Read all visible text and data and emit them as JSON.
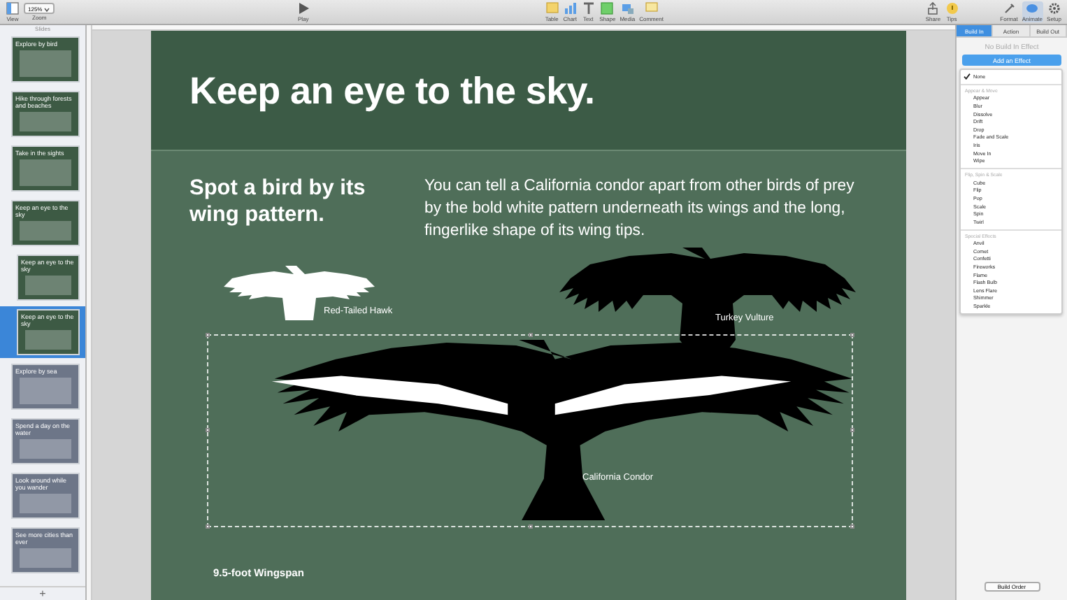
{
  "toolbar": {
    "left": [
      {
        "label": "View"
      },
      {
        "label": "Zoom",
        "value": "125%"
      }
    ],
    "play": {
      "label": "Play"
    },
    "insert": [
      {
        "label": "Table"
      },
      {
        "label": "Chart"
      },
      {
        "label": "Text"
      },
      {
        "label": "Shape"
      },
      {
        "label": "Media"
      },
      {
        "label": "Comment"
      }
    ],
    "share": [
      {
        "label": "Share"
      },
      {
        "label": "Tips"
      }
    ],
    "right": [
      {
        "label": "Format",
        "selected": false
      },
      {
        "label": "Animate",
        "selected": true
      },
      {
        "label": "Setup",
        "selected": false
      }
    ]
  },
  "sidebar": {
    "title": "Slides",
    "thumbnails": [
      {
        "title": "Explore by bird",
        "selected": false
      },
      {
        "title": "Hike through forests and beaches",
        "selected": false
      },
      {
        "title": "Take in the sights",
        "selected": false
      },
      {
        "title": "Keep an eye to the sky",
        "selected": false,
        "children": [
          {
            "title": "Keep an eye to the sky",
            "selected": false
          },
          {
            "title": "Keep an eye to the sky",
            "selected": true
          }
        ]
      },
      {
        "title": "Explore by sea",
        "selected": false
      },
      {
        "title": "Spend a day on the water",
        "selected": false
      },
      {
        "title": "Look around while you wander",
        "selected": false
      },
      {
        "title": "See more cities than ever",
        "selected": false
      }
    ],
    "add": "+"
  },
  "slide": {
    "title": "Keep an eye to the sky.",
    "subtitle": "Spot a bird by its wing pattern.",
    "body": "You can tell a California condor apart from other birds of prey by the bold white pattern underneath its wings and the long, fingerlike shape of its wing tips.",
    "birds": [
      {
        "kind": "hawk",
        "label": "Red-Tailed Hawk"
      },
      {
        "kind": "vulture",
        "label": "Turkey Vulture"
      },
      {
        "kind": "condor",
        "label": "California Condor",
        "selected": true
      }
    ],
    "caption": "9.5-foot Wingspan"
  },
  "inspector": {
    "tabs": [
      {
        "label": "Build In",
        "selected": true
      },
      {
        "label": "Action",
        "selected": false
      },
      {
        "label": "Build Out",
        "selected": false
      }
    ],
    "status": "No Build In Effect",
    "add_button": "Add an Effect",
    "menu": [
      {
        "kind": "item",
        "label": "None",
        "checked": true
      },
      {
        "kind": "header",
        "label": "Appear & Move"
      },
      {
        "kind": "item",
        "label": "Appear",
        "checked": false
      },
      {
        "kind": "item",
        "label": "Blur",
        "checked": false
      },
      {
        "kind": "item",
        "label": "Dissolve",
        "checked": false
      },
      {
        "kind": "item",
        "label": "Drift",
        "checked": false
      },
      {
        "kind": "item",
        "label": "Drop",
        "checked": false
      },
      {
        "kind": "item",
        "label": "Fade and Scale",
        "checked": false
      },
      {
        "kind": "item",
        "label": "Iris",
        "checked": false
      },
      {
        "kind": "item",
        "label": "Move In",
        "checked": false
      },
      {
        "kind": "item",
        "label": "Wipe",
        "checked": false
      },
      {
        "kind": "header",
        "label": "Flip, Spin & Scale"
      },
      {
        "kind": "item",
        "label": "Cube",
        "checked": false
      },
      {
        "kind": "item",
        "label": "Flip",
        "checked": false
      },
      {
        "kind": "item",
        "label": "Pop",
        "checked": false
      },
      {
        "kind": "item",
        "label": "Scale",
        "checked": false
      },
      {
        "kind": "item",
        "label": "Spin",
        "checked": false
      },
      {
        "kind": "item",
        "label": "Twirl",
        "checked": false
      },
      {
        "kind": "header",
        "label": "Special Effects"
      },
      {
        "kind": "item",
        "label": "Anvil",
        "checked": false
      },
      {
        "kind": "item",
        "label": "Comet",
        "checked": false
      },
      {
        "kind": "item",
        "label": "Confetti",
        "checked": false
      },
      {
        "kind": "item",
        "label": "Fireworks",
        "checked": false
      },
      {
        "kind": "item",
        "label": "Flame",
        "checked": false
      },
      {
        "kind": "item",
        "label": "Flash Bulb",
        "checked": false
      },
      {
        "kind": "item",
        "label": "Lens Flare",
        "checked": false
      },
      {
        "kind": "item",
        "label": "Shimmer",
        "checked": false
      },
      {
        "kind": "item",
        "label": "Sparkle",
        "checked": false
      }
    ],
    "build_order": "Build Order"
  }
}
